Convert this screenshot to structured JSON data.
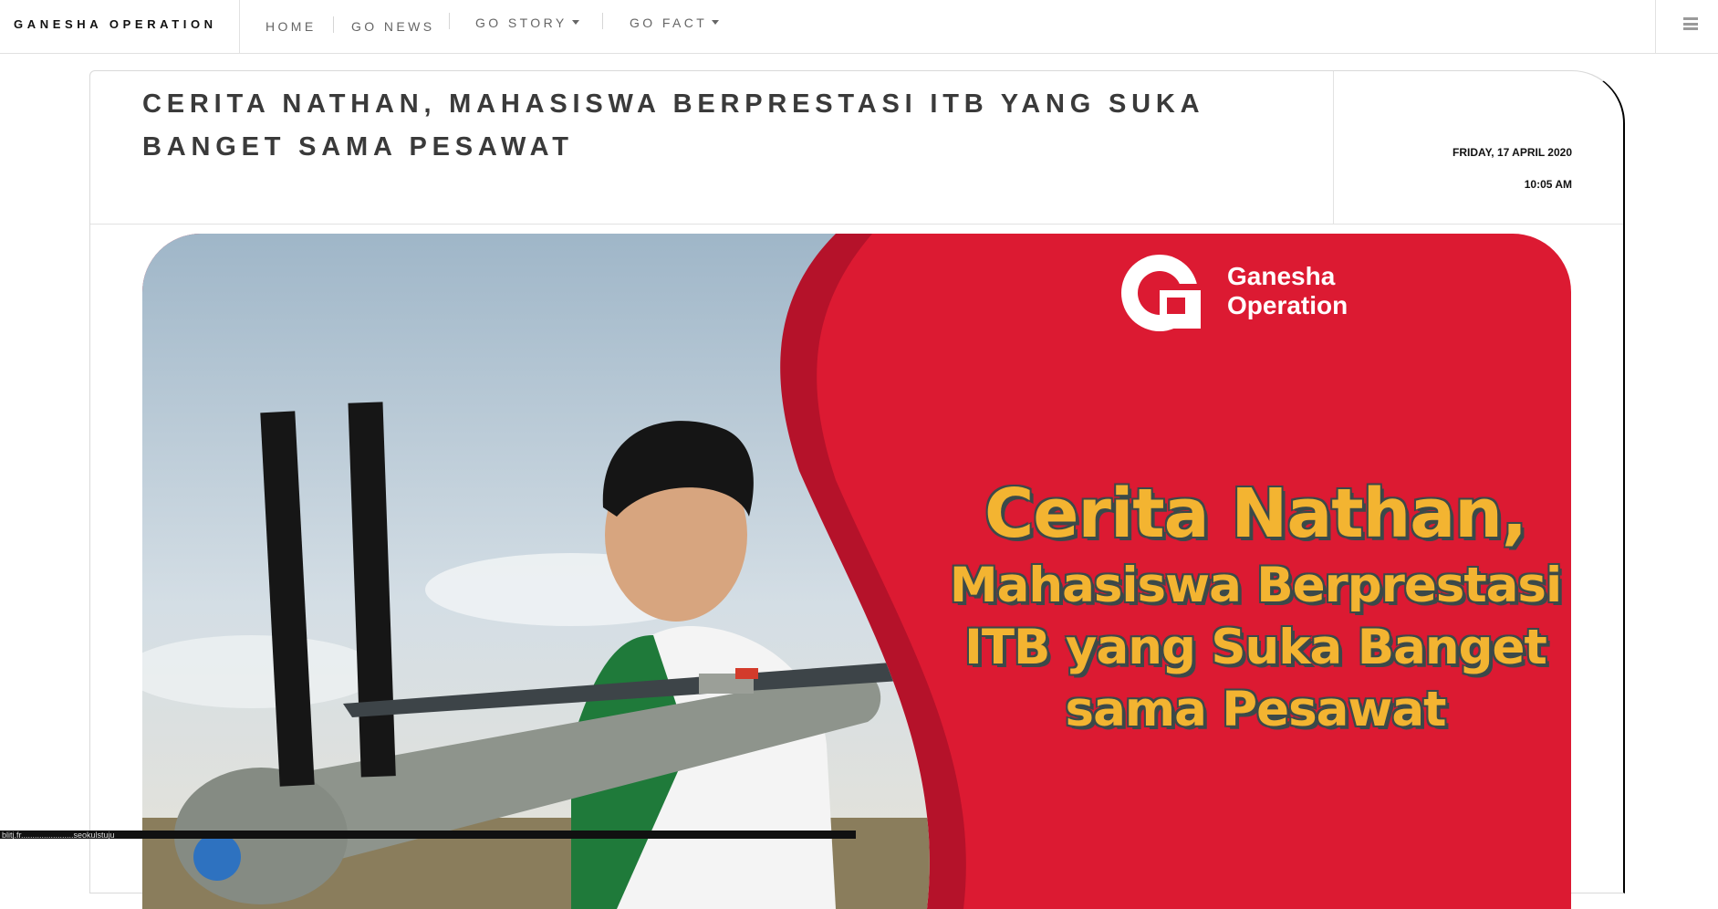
{
  "navbar": {
    "brand": "GANESHA OPERATION",
    "items": [
      {
        "label": "HOME"
      },
      {
        "label": "GO NEWS"
      },
      {
        "label": "GO STORY"
      },
      {
        "label": "GO FACT"
      }
    ],
    "menu_icon": "hamburger-icon"
  },
  "article": {
    "title": "CERITA NATHAN, MAHASISWA BERPRESTASI ITB YANG SUKA BANGET SAMA PESAWAT",
    "date": "FRIDAY, 17 APRIL 2020",
    "time": "10:05 AM"
  },
  "hero": {
    "logo_line1": "Ganesha",
    "logo_line2": "Operation",
    "headline_line1": "Cerita Nathan,",
    "headline_line2": "Mahasiswa Berprestasi",
    "headline_line3": "ITB yang Suka Banget",
    "headline_line4": "sama Pesawat"
  },
  "colors": {
    "brand_red": "#dc1a32",
    "headline_yellow": "#f3b431",
    "headline_outline": "#3c4a4a"
  },
  "statusbar": {
    "text": "blitj.fr.......................seokulstuju"
  }
}
